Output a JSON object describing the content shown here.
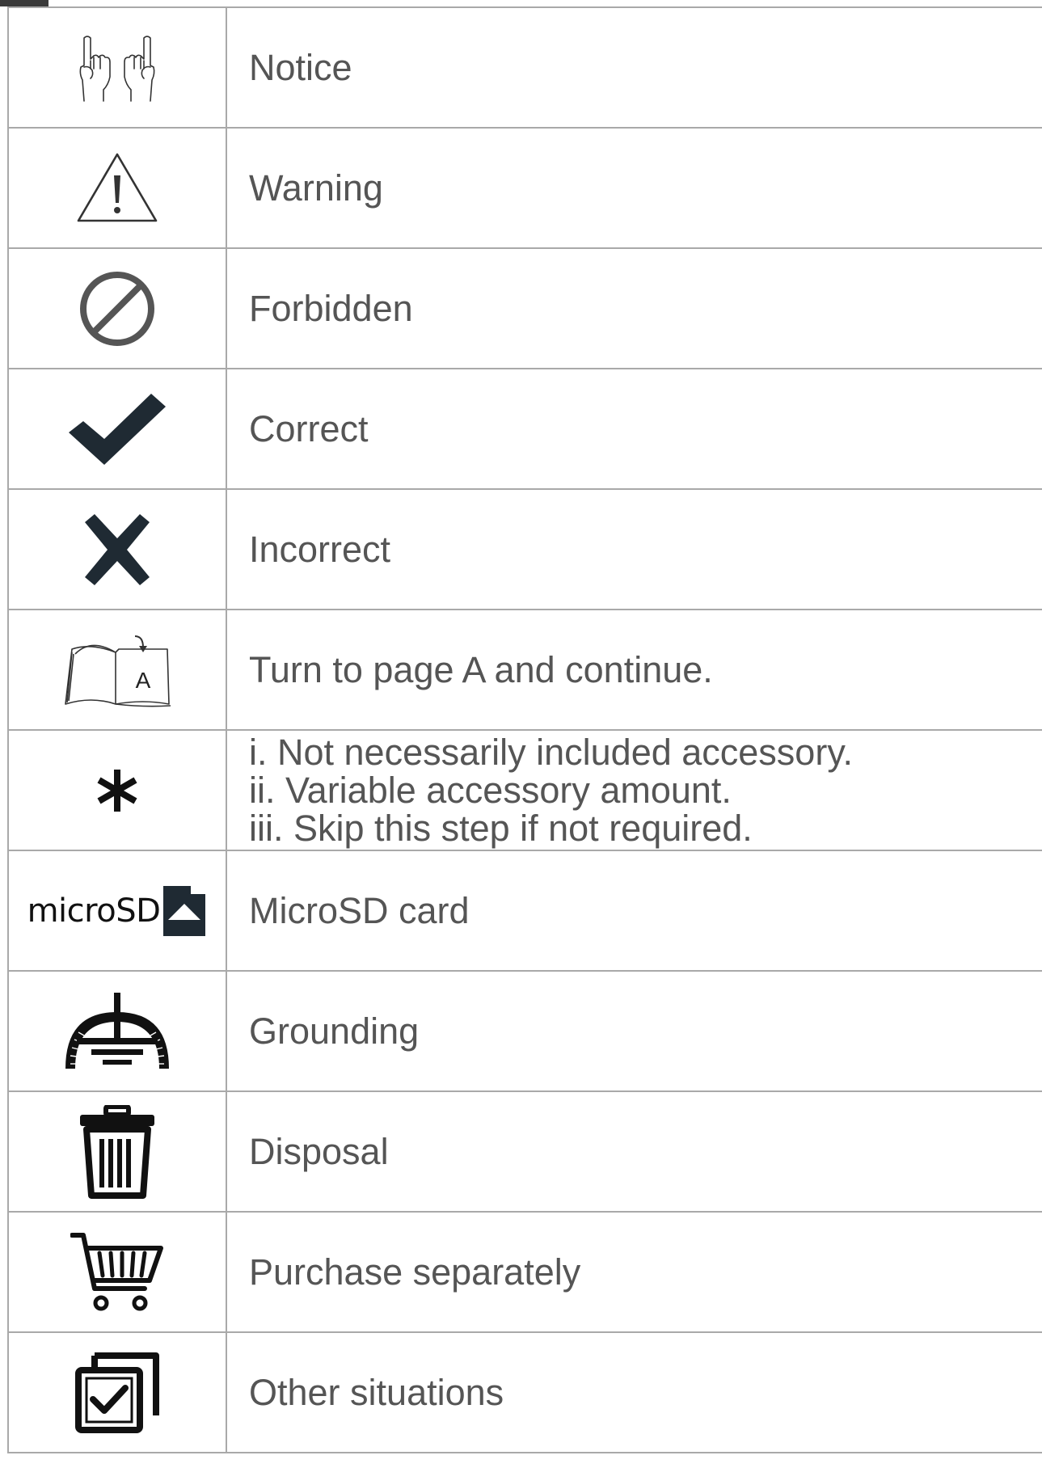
{
  "rows": [
    {
      "icon": "notice-hands-icon",
      "label": "Notice"
    },
    {
      "icon": "warning-triangle-icon",
      "label": "Warning"
    },
    {
      "icon": "forbidden-icon",
      "label": "Forbidden"
    },
    {
      "icon": "checkmark-icon",
      "label": "Correct"
    },
    {
      "icon": "x-mark-icon",
      "label": "Incorrect"
    },
    {
      "icon": "open-book-icon",
      "icon_letter": "A",
      "label": "Turn to page A and continue."
    },
    {
      "icon": "asterisk-icon",
      "icon_glyph": "*",
      "lines": [
        "i. Not necessarily included accessory.",
        "ii. Variable accessory amount.",
        "iii. Skip this step if not required."
      ]
    },
    {
      "icon": "microsd-card-icon",
      "icon_text": "microSD",
      "label": "MicroSD card"
    },
    {
      "icon": "grounding-icon",
      "label": "Grounding"
    },
    {
      "icon": "trash-can-icon",
      "label": "Disposal"
    },
    {
      "icon": "shopping-cart-icon",
      "label": "Purchase separately"
    },
    {
      "icon": "checkbox-stack-icon",
      "label": "Other situations"
    }
  ],
  "colors": {
    "icon": "#1f2a33",
    "text": "#555555",
    "border": "#a9a9a9"
  }
}
